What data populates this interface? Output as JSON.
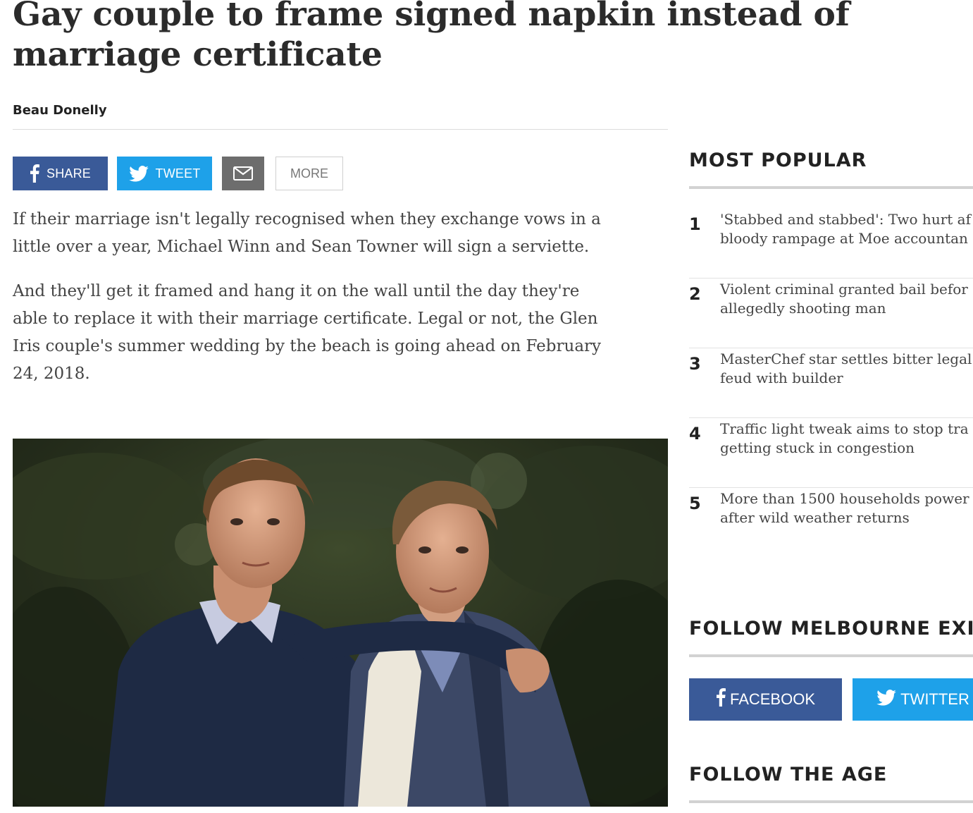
{
  "article": {
    "headline": "Gay couple to frame signed napkin instead of marriage certificate",
    "byline": "Beau Donelly",
    "paragraphs": [
      "If their marriage isn't legally recognised when they exchange vows in a little over a year, Michael Winn and Sean Towner will sign a serviette.",
      "And they'll get it framed and hang it on the wall until the day they're able to replace it with their marriage certificate. Legal or not, the Glen Iris couple's summer wedding by the beach is going ahead on February 24, 2018."
    ]
  },
  "share": {
    "facebook_label": "SHARE",
    "twitter_label": "TWEET",
    "more_label": "MORE",
    "colors": {
      "facebook": "#3a5a98",
      "twitter": "#1ea1e9",
      "email": "#6d6d6d"
    },
    "icons": [
      "facebook-icon",
      "twitter-icon",
      "email-icon"
    ]
  },
  "sidebar": {
    "most_popular_title": "MOST POPULAR",
    "most_popular": [
      {
        "rank": "1",
        "title": "'Stabbed and stabbed': Two hurt af\nbloody rampage at Moe accountan"
      },
      {
        "rank": "2",
        "title": "Violent criminal granted bail befor\nallegedly shooting man"
      },
      {
        "rank": "3",
        "title": "MasterChef star settles bitter legal\nfeud with builder"
      },
      {
        "rank": "4",
        "title": "Traffic light tweak aims to stop tra\ngetting stuck in congestion"
      },
      {
        "rank": "5",
        "title": "More than 1500 households power\nafter wild weather returns"
      }
    ],
    "follow_melbourne_title": "FOLLOW MELBOURNE EXI",
    "follow_facebook_label": "FACEBOOK",
    "follow_twitter_label": "TWITTER",
    "follow_age_title": "FOLLOW THE AGE"
  }
}
